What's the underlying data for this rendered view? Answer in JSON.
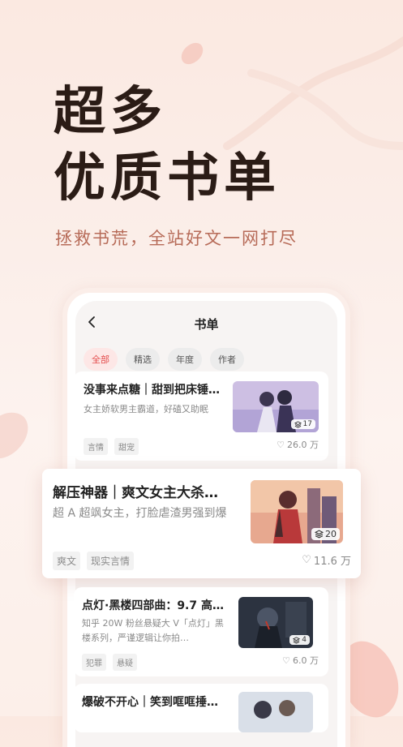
{
  "hero": {
    "line1": "超多",
    "line2": "优质书单",
    "subtitle": "拯救书荒，全站好文一网打尽"
  },
  "nav": {
    "title": "书单",
    "back_icon": "chevron-left-icon"
  },
  "filters": [
    {
      "label": "全部",
      "active": true
    },
    {
      "label": "精选",
      "active": false
    },
    {
      "label": "年度",
      "active": false
    },
    {
      "label": "作者",
      "active": false
    }
  ],
  "cards": [
    {
      "title": "没事来点糖｜甜到把床锤…",
      "desc": "女主娇软男主霸道，好磕又助眠",
      "tags": [
        "言情",
        "甜宠"
      ],
      "likes": "26.0 万",
      "count": "17"
    },
    {
      "title": "解压神器｜爽文女主大杀…",
      "desc": "超 A 超飒女主，打脸虐渣男强到爆",
      "tags": [
        "爽文",
        "现实言情"
      ],
      "likes": "11.6 万",
      "count": "20"
    },
    {
      "title": "点灯·黑楼四部曲：9.7 高…",
      "desc": "知乎 20W 粉丝悬疑大 V「点灯」黑楼系列，严谨逻辑让你拍…",
      "tags": [
        "犯罪",
        "悬疑"
      ],
      "likes": "6.0 万",
      "count": "4"
    },
    {
      "title": "爆破不开心｜笑到哐哐捶…"
    }
  ],
  "colors": {
    "accent": "#e44c4c",
    "headline": "#2b1c16",
    "subtitle": "#b76b58"
  }
}
